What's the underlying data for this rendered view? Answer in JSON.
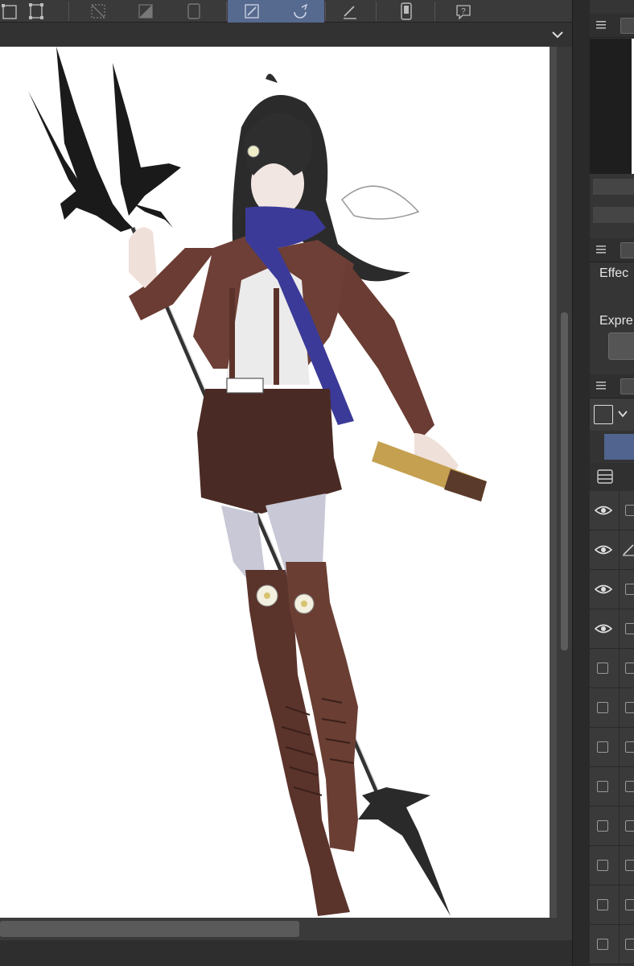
{
  "app": {
    "accent_color": "#56698f",
    "panel_bg": "#353535",
    "canvas_bg": "#ffffff"
  },
  "toolbar": {
    "tools": [
      {
        "icon": "select-transform-icon",
        "active": false
      },
      {
        "icon": "crop-grid-icon",
        "active": false
      },
      {
        "icon": "clear-selection-icon",
        "active": false
      },
      {
        "icon": "invert-selection-icon",
        "active": false
      },
      {
        "icon": "page-icon",
        "active": false
      },
      {
        "icon": "pen-edit-icon",
        "active": true
      },
      {
        "icon": "rotate-icon",
        "active": true
      },
      {
        "icon": "ruler-pen-icon",
        "active": false
      },
      {
        "icon": "smartphone-icon",
        "active": false
      },
      {
        "icon": "help-icon",
        "active": false
      }
    ]
  },
  "panel": {
    "effect_label": "Effec",
    "expression_label": "Expre"
  },
  "layers": [
    {
      "visible": true,
      "icon": ""
    },
    {
      "visible": true,
      "icon": "pencil-icon"
    },
    {
      "visible": true,
      "icon": ""
    },
    {
      "visible": true,
      "icon": ""
    },
    {
      "visible": false,
      "icon": ""
    },
    {
      "visible": false,
      "icon": ""
    },
    {
      "visible": false,
      "icon": ""
    },
    {
      "visible": false,
      "icon": ""
    },
    {
      "visible": false,
      "icon": ""
    },
    {
      "visible": false,
      "icon": ""
    },
    {
      "visible": false,
      "icon": ""
    },
    {
      "visible": false,
      "icon": ""
    }
  ]
}
